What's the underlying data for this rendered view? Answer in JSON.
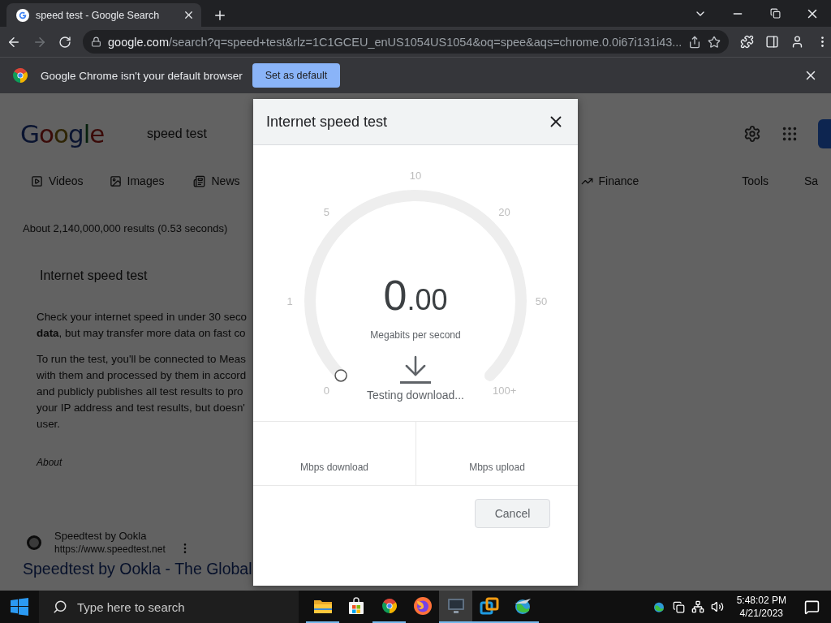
{
  "browser": {
    "tab": {
      "title": "speed test - Google Search",
      "selected": true
    },
    "address": {
      "domain": "google.com",
      "path": "/search?q=speed+test&rlz=1C1GCEU_enUS1054US1054&oq=spee&aqs=chrome.0.0i67i131i43..."
    },
    "forward_disabled": true,
    "infobar": {
      "message": "Google Chrome isn't your default browser",
      "button": "Set as default"
    }
  },
  "page": {
    "logo": "Google",
    "query": "speed test",
    "tabs": [
      {
        "label": "Videos",
        "kind": "video"
      },
      {
        "label": "Images",
        "kind": "image"
      },
      {
        "label": "News",
        "kind": "news"
      },
      {
        "label": "Finance",
        "kind": "finance"
      },
      {
        "label": "Tools",
        "kind": "plain"
      },
      {
        "label": "Sa",
        "kind": "plain"
      }
    ],
    "results_count": "About 2,140,000,000 results (0.53 seconds)",
    "card": {
      "title": "Internet speed test",
      "paragraphs": [
        [
          "Check your internet speed in under 30 seco",
          "**data**, but may transfer more data on fast co"
        ],
        [
          "To run the test, you'll be connected to Meas",
          "with them and processed by them in accord",
          "and publicly publishes all test results to pro",
          "your IP address and test results, but doesn'",
          "user."
        ]
      ],
      "about": "About"
    },
    "result": {
      "site": "Speedtest by Ookla",
      "url": "https://www.speedtest.net",
      "title": "Speedtest by Ookla - The Global"
    }
  },
  "dialog": {
    "title": "Internet speed test",
    "gauge": {
      "ticks": [
        "0",
        "1",
        "5",
        "10",
        "20",
        "50",
        "100+"
      ]
    },
    "reading": {
      "whole": "0",
      "fraction": ".00"
    },
    "unit": "Megabits per second",
    "status": "Testing download...",
    "stats": [
      "Mbps download",
      "Mbps upload"
    ],
    "cancel": "Cancel"
  },
  "taskbar": {
    "search_placeholder": "Type here to search",
    "apps": [
      {
        "kind": "folder",
        "running": true,
        "selected": false
      },
      {
        "kind": "store",
        "running": false,
        "selected": false
      },
      {
        "kind": "chrome",
        "running": true,
        "selected": false
      },
      {
        "kind": "firefox",
        "running": false,
        "selected": false
      },
      {
        "kind": "monitor",
        "running": true,
        "selected": true
      },
      {
        "kind": "vm",
        "running": true,
        "selected": false
      },
      {
        "kind": "globe",
        "running": true,
        "selected": false
      }
    ],
    "time": "5:48:02 PM",
    "date": "4/21/2023"
  }
}
